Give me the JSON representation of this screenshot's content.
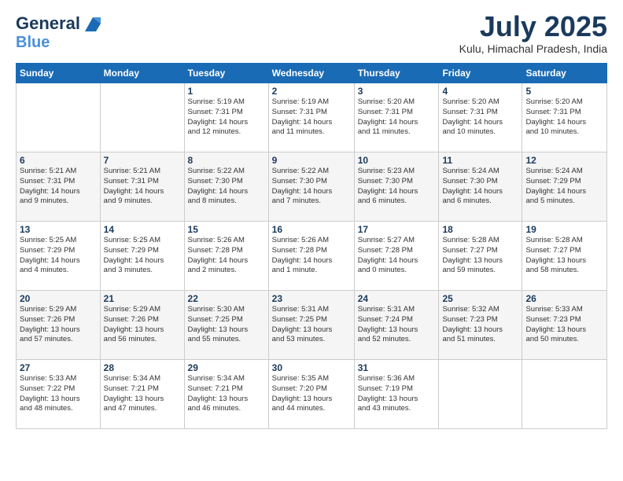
{
  "logo": {
    "line1": "General",
    "line2": "Blue"
  },
  "title": "July 2025",
  "location": "Kulu, Himachal Pradesh, India",
  "days_header": [
    "Sunday",
    "Monday",
    "Tuesday",
    "Wednesday",
    "Thursday",
    "Friday",
    "Saturday"
  ],
  "weeks": [
    [
      {
        "num": "",
        "info": ""
      },
      {
        "num": "",
        "info": ""
      },
      {
        "num": "1",
        "info": "Sunrise: 5:19 AM\nSunset: 7:31 PM\nDaylight: 14 hours\nand 12 minutes."
      },
      {
        "num": "2",
        "info": "Sunrise: 5:19 AM\nSunset: 7:31 PM\nDaylight: 14 hours\nand 11 minutes."
      },
      {
        "num": "3",
        "info": "Sunrise: 5:20 AM\nSunset: 7:31 PM\nDaylight: 14 hours\nand 11 minutes."
      },
      {
        "num": "4",
        "info": "Sunrise: 5:20 AM\nSunset: 7:31 PM\nDaylight: 14 hours\nand 10 minutes."
      },
      {
        "num": "5",
        "info": "Sunrise: 5:20 AM\nSunset: 7:31 PM\nDaylight: 14 hours\nand 10 minutes."
      }
    ],
    [
      {
        "num": "6",
        "info": "Sunrise: 5:21 AM\nSunset: 7:31 PM\nDaylight: 14 hours\nand 9 minutes."
      },
      {
        "num": "7",
        "info": "Sunrise: 5:21 AM\nSunset: 7:31 PM\nDaylight: 14 hours\nand 9 minutes."
      },
      {
        "num": "8",
        "info": "Sunrise: 5:22 AM\nSunset: 7:30 PM\nDaylight: 14 hours\nand 8 minutes."
      },
      {
        "num": "9",
        "info": "Sunrise: 5:22 AM\nSunset: 7:30 PM\nDaylight: 14 hours\nand 7 minutes."
      },
      {
        "num": "10",
        "info": "Sunrise: 5:23 AM\nSunset: 7:30 PM\nDaylight: 14 hours\nand 6 minutes."
      },
      {
        "num": "11",
        "info": "Sunrise: 5:24 AM\nSunset: 7:30 PM\nDaylight: 14 hours\nand 6 minutes."
      },
      {
        "num": "12",
        "info": "Sunrise: 5:24 AM\nSunset: 7:29 PM\nDaylight: 14 hours\nand 5 minutes."
      }
    ],
    [
      {
        "num": "13",
        "info": "Sunrise: 5:25 AM\nSunset: 7:29 PM\nDaylight: 14 hours\nand 4 minutes."
      },
      {
        "num": "14",
        "info": "Sunrise: 5:25 AM\nSunset: 7:29 PM\nDaylight: 14 hours\nand 3 minutes."
      },
      {
        "num": "15",
        "info": "Sunrise: 5:26 AM\nSunset: 7:28 PM\nDaylight: 14 hours\nand 2 minutes."
      },
      {
        "num": "16",
        "info": "Sunrise: 5:26 AM\nSunset: 7:28 PM\nDaylight: 14 hours\nand 1 minute."
      },
      {
        "num": "17",
        "info": "Sunrise: 5:27 AM\nSunset: 7:28 PM\nDaylight: 14 hours\nand 0 minutes."
      },
      {
        "num": "18",
        "info": "Sunrise: 5:28 AM\nSunset: 7:27 PM\nDaylight: 13 hours\nand 59 minutes."
      },
      {
        "num": "19",
        "info": "Sunrise: 5:28 AM\nSunset: 7:27 PM\nDaylight: 13 hours\nand 58 minutes."
      }
    ],
    [
      {
        "num": "20",
        "info": "Sunrise: 5:29 AM\nSunset: 7:26 PM\nDaylight: 13 hours\nand 57 minutes."
      },
      {
        "num": "21",
        "info": "Sunrise: 5:29 AM\nSunset: 7:26 PM\nDaylight: 13 hours\nand 56 minutes."
      },
      {
        "num": "22",
        "info": "Sunrise: 5:30 AM\nSunset: 7:25 PM\nDaylight: 13 hours\nand 55 minutes."
      },
      {
        "num": "23",
        "info": "Sunrise: 5:31 AM\nSunset: 7:25 PM\nDaylight: 13 hours\nand 53 minutes."
      },
      {
        "num": "24",
        "info": "Sunrise: 5:31 AM\nSunset: 7:24 PM\nDaylight: 13 hours\nand 52 minutes."
      },
      {
        "num": "25",
        "info": "Sunrise: 5:32 AM\nSunset: 7:23 PM\nDaylight: 13 hours\nand 51 minutes."
      },
      {
        "num": "26",
        "info": "Sunrise: 5:33 AM\nSunset: 7:23 PM\nDaylight: 13 hours\nand 50 minutes."
      }
    ],
    [
      {
        "num": "27",
        "info": "Sunrise: 5:33 AM\nSunset: 7:22 PM\nDaylight: 13 hours\nand 48 minutes."
      },
      {
        "num": "28",
        "info": "Sunrise: 5:34 AM\nSunset: 7:21 PM\nDaylight: 13 hours\nand 47 minutes."
      },
      {
        "num": "29",
        "info": "Sunrise: 5:34 AM\nSunset: 7:21 PM\nDaylight: 13 hours\nand 46 minutes."
      },
      {
        "num": "30",
        "info": "Sunrise: 5:35 AM\nSunset: 7:20 PM\nDaylight: 13 hours\nand 44 minutes."
      },
      {
        "num": "31",
        "info": "Sunrise: 5:36 AM\nSunset: 7:19 PM\nDaylight: 13 hours\nand 43 minutes."
      },
      {
        "num": "",
        "info": ""
      },
      {
        "num": "",
        "info": ""
      }
    ]
  ]
}
